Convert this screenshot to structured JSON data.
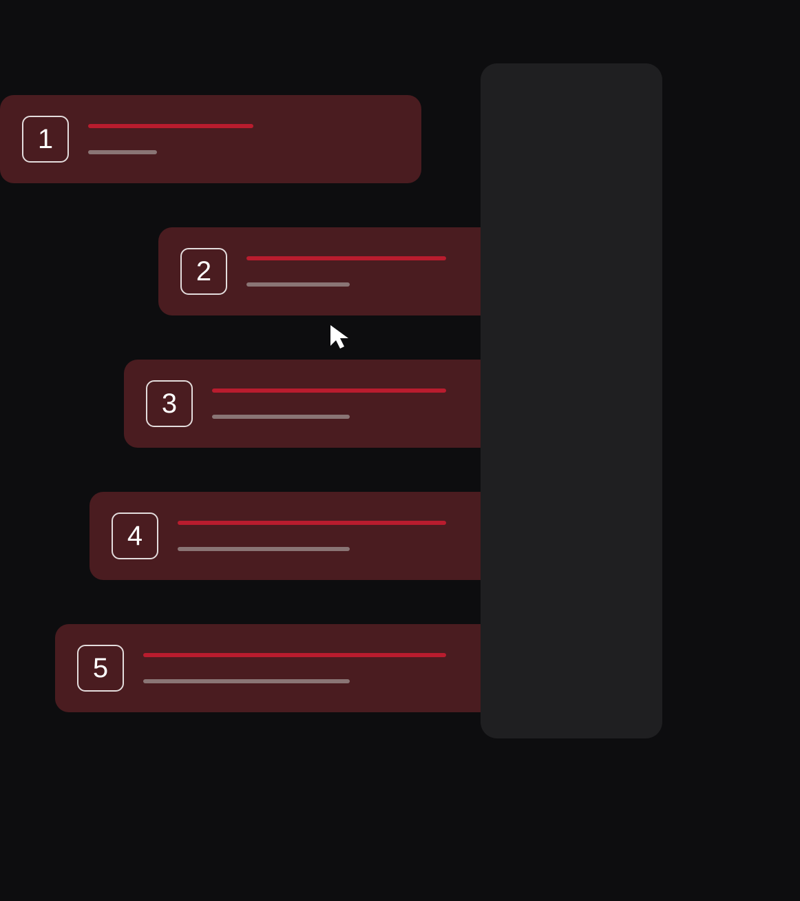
{
  "cards": [
    {
      "number": "1"
    },
    {
      "number": "2"
    },
    {
      "number": "3"
    },
    {
      "number": "4"
    },
    {
      "number": "5"
    }
  ],
  "colors": {
    "background": "#0d0d0f",
    "panel": "#1f1f21",
    "card": "#4a1c20",
    "primaryLine": "#b91c2e",
    "secondaryLine": "#8a7575",
    "text": "#ffffff"
  }
}
